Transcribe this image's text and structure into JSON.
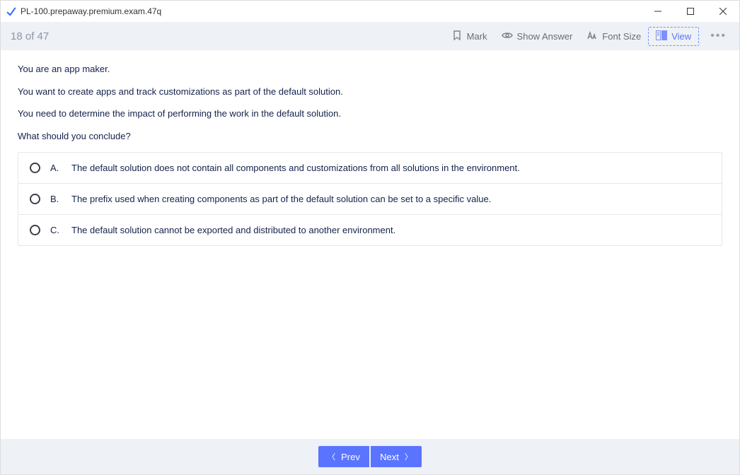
{
  "window": {
    "title": "PL-100.prepaway.premium.exam.47q"
  },
  "toolbar": {
    "counter": "18 of 47",
    "mark_label": "Mark",
    "show_answer_label": "Show Answer",
    "font_size_label": "Font Size",
    "view_label": "View"
  },
  "question": {
    "paragraphs": [
      "You are an app maker.",
      "You want to create apps and track customizations as part of the default solution.",
      "You need to determine the impact of performing the work in the default solution.",
      "What should you conclude?"
    ],
    "options": [
      {
        "letter": "A.",
        "text": "The default solution does not contain all components and customizations from all solutions in the environment."
      },
      {
        "letter": "B.",
        "text": "The prefix used when creating components as part of the default solution can be set to a specific value."
      },
      {
        "letter": "C.",
        "text": "The default solution cannot be exported and distributed to another environment."
      }
    ]
  },
  "footer": {
    "prev_label": "Prev",
    "next_label": "Next"
  }
}
